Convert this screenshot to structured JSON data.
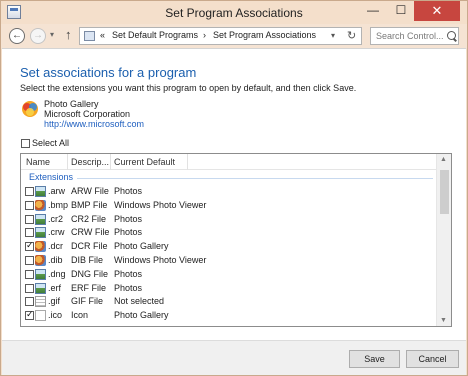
{
  "window": {
    "title": "Set Program Associations",
    "minimize_glyph": "—",
    "maximize_glyph": "☐",
    "close_glyph": "✕"
  },
  "nav": {
    "back_glyph": "←",
    "forward_glyph": "→",
    "recent_glyph": "▾",
    "up_glyph": "↑",
    "crumb_overflow": "«",
    "crumb_sep": "›",
    "breadcrumbs": [
      "Set Default Programs",
      "Set Program Associations"
    ],
    "dropdown_glyph": "▾",
    "refresh_glyph": "↻",
    "search_placeholder": "Search Control..."
  },
  "main": {
    "heading": "Set associations for a program",
    "instruction": "Select the extensions you want this program to open by default, and then click Save.",
    "program": {
      "name": "Photo Gallery",
      "publisher": "Microsoft Corporation",
      "url": "http://www.microsoft.com"
    },
    "select_all_label": "Select All",
    "select_all_checked": false,
    "columns": [
      "Name",
      "Descrip...",
      "Current Default"
    ],
    "sort_glyph": "^",
    "group_label": "Extensions",
    "rows": [
      {
        "ext": ".arw",
        "desc": "ARW File",
        "default": "Photos",
        "checked": false,
        "icon": "image-file-icon"
      },
      {
        "ext": ".bmp",
        "desc": "BMP File",
        "default": "Windows Photo Viewer",
        "checked": false,
        "icon": "photo-gallery-file-icon"
      },
      {
        "ext": ".cr2",
        "desc": "CR2 File",
        "default": "Photos",
        "checked": false,
        "icon": "image-file-icon"
      },
      {
        "ext": ".crw",
        "desc": "CRW File",
        "default": "Photos",
        "checked": false,
        "icon": "image-file-icon"
      },
      {
        "ext": ".dcr",
        "desc": "DCR File",
        "default": "Photo Gallery",
        "checked": true,
        "icon": "photo-gallery-file-icon"
      },
      {
        "ext": ".dib",
        "desc": "DIB File",
        "default": "Windows Photo Viewer",
        "checked": false,
        "icon": "photo-gallery-file-icon"
      },
      {
        "ext": ".dng",
        "desc": "DNG File",
        "default": "Photos",
        "checked": false,
        "icon": "image-file-icon"
      },
      {
        "ext": ".erf",
        "desc": "ERF File",
        "default": "Photos",
        "checked": false,
        "icon": "image-file-icon"
      },
      {
        "ext": ".gif",
        "desc": "GIF File",
        "default": "Not selected",
        "checked": false,
        "icon": "gif-file-icon"
      },
      {
        "ext": ".ico",
        "desc": "Icon",
        "default": "Photo Gallery",
        "checked": true,
        "icon": "blank-file-icon"
      }
    ],
    "scroll_up_glyph": "▲",
    "scroll_down_glyph": "▼"
  },
  "footer": {
    "save_label": "Save",
    "cancel_label": "Cancel"
  },
  "colors": {
    "title_bar": "#f4dfcb",
    "heading": "#1b5fae",
    "link": "#1f5fbf",
    "close_button": "#c7463f"
  }
}
